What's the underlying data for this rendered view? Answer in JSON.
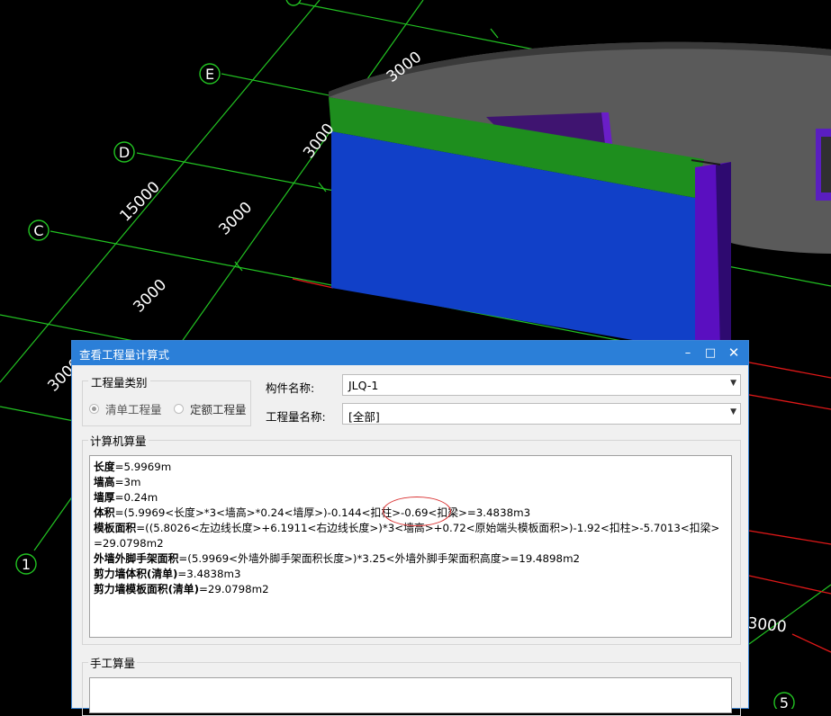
{
  "viewport": {
    "axis_labels": [
      "E",
      "D",
      "C",
      "1",
      "5"
    ],
    "dimensions": [
      "3000",
      "3000",
      "15000",
      "3000",
      "3000",
      "3000",
      "3000"
    ]
  },
  "dialog": {
    "title": "查看工程量计算式",
    "controls": {
      "minimize": "–",
      "maximize": "□",
      "close": "✕"
    },
    "type_group": {
      "legend": "工程量类别",
      "options": [
        "清单工程量",
        "定额工程量"
      ],
      "selected": "清单工程量"
    },
    "component": {
      "label": "构件名称:",
      "value": "JLQ-1"
    },
    "quantity": {
      "label": "工程量名称:",
      "value": "[全部]"
    },
    "calc": {
      "legend": "计算机算量",
      "lines": [
        {
          "name": "长度",
          "formula": "=5.9969m"
        },
        {
          "name": "墙高",
          "formula": "=3m"
        },
        {
          "name": "墙厚",
          "formula": "=0.24m"
        },
        {
          "name": "体积",
          "formula": "=(5.9969<长度>*3<墙高>*0.24<墙厚>)-0.144<扣柱>-0.69<扣梁>=3.4838m3"
        },
        {
          "name": "模板面积",
          "formula": "=((5.8026<左边线长度>+6.1911<右边线长度>)*3<墙高>+0.72<原始端头模板面积>)-1.92<扣柱>-5.7013<扣梁>=29.0798m2"
        },
        {
          "name": "外墙外脚手架面积",
          "formula": "=(5.9969<外墙外脚手架面积长度>)*3.25<外墙外脚手架面积高度>=19.4898m2"
        },
        {
          "name": "剪力墙体积(清单)",
          "formula": "=3.4838m3"
        },
        {
          "name": "剪力墙模板面积(清单)",
          "formula": "=29.0798m2"
        }
      ]
    },
    "manual": {
      "legend": "手工算量"
    }
  },
  "colors": {
    "wall_face": "#1140c8",
    "wall_top_band": "#1e8e1e",
    "wall_edge": "#5a0fc0",
    "slab_gray": "#5a5a5a",
    "grid_green": "#22c322",
    "grid_red": "#e01818",
    "titlebar_blue": "#2b7fd8",
    "annotation_red": "#d93030"
  }
}
